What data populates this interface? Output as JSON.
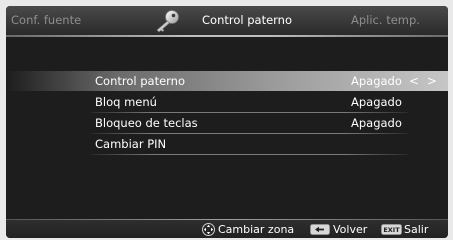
{
  "header": {
    "tab_left": "Conf. fuente",
    "tab_center": "Control paterno",
    "tab_right": "Aplic. temp.",
    "center_icon": "key-icon"
  },
  "menu": {
    "items": [
      {
        "label": "Control paterno",
        "value": "Apagado",
        "selected": true,
        "arrows": "< >"
      },
      {
        "label": "Bloq menú",
        "value": "Apagado"
      },
      {
        "label": "Bloqueo de teclas",
        "value": "Apagado"
      },
      {
        "label": "Cambiar PIN",
        "value": ""
      }
    ]
  },
  "footer": {
    "change_zone": "Cambiar zona",
    "back": "Volver",
    "exit_key": "EXIT",
    "exit": "Salir",
    "icons": [
      "dpad-icon",
      "back-key-icon",
      "exit-key-icon"
    ]
  }
}
